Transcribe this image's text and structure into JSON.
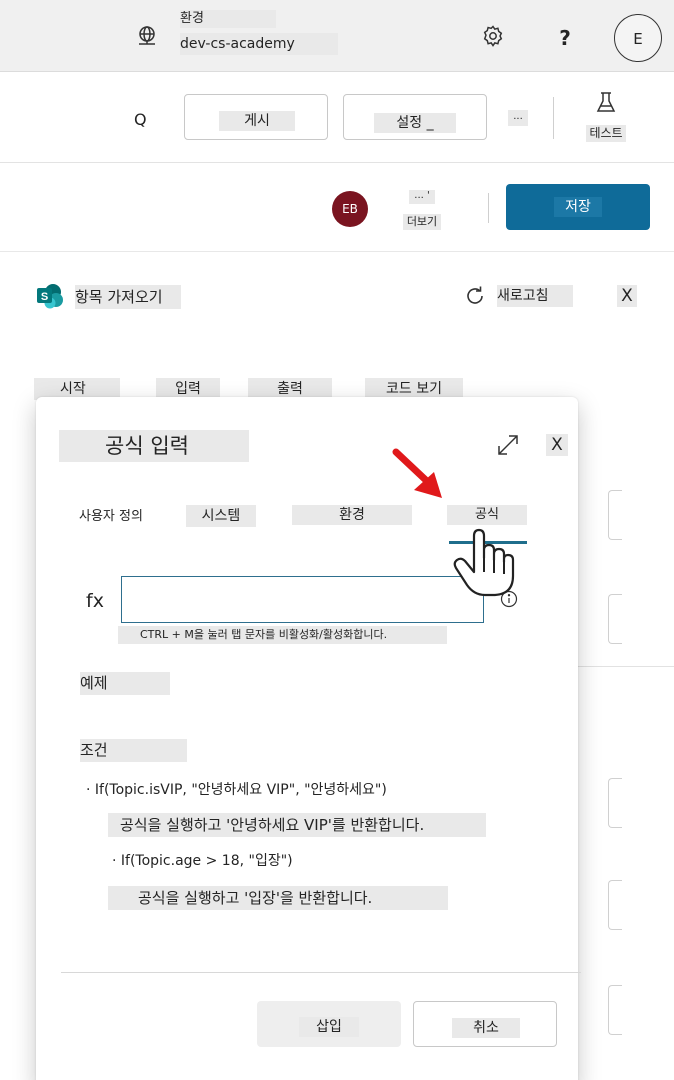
{
  "env": {
    "label": "환경",
    "name": "dev-cs-academy",
    "help": "?",
    "avatar": "E"
  },
  "cmd": {
    "search": "Q",
    "publish": "게시",
    "settings": "설정 _",
    "more": "...",
    "test": "테스트"
  },
  "save_row": {
    "avatar": "EB",
    "more_dots": "... '",
    "more_label": "더보기",
    "save": "저장"
  },
  "panel": {
    "title": "항목 가져오기",
    "refresh": "새로고침",
    "close": "X"
  },
  "bg_tabs": [
    "시작",
    "입력",
    "출력",
    "코드 보기"
  ],
  "dialog": {
    "title": "공식 입력",
    "close": "X",
    "tabs": [
      "사용자 정의",
      "시스템",
      "환경",
      "공식"
    ],
    "fx_label": "fx",
    "fx_value": "",
    "hint": "CTRL + M을 눌러 탭 문자를 비활성화/활성화합니다.",
    "examples_heading": "예제",
    "condition_heading": "조건",
    "example1_code": "· If(Topic.isVIP, \"안녕하세요 VIP\", \"안녕하세요\")",
    "example1_desc": "공식을 실행하고 '안녕하세요 VIP'를 반환합니다.",
    "example2_code": "· If(Topic.age > 18, \"입장\")",
    "example2_desc": "공식을 실행하고 '입장'을 반환합니다.",
    "insert": "삽입",
    "cancel": "취소"
  },
  "colors": {
    "accent": "#0f6b99",
    "tab_underline": "#1f6e8c",
    "arrow": "#e0191b",
    "avatar_eb": "#7a1420"
  }
}
